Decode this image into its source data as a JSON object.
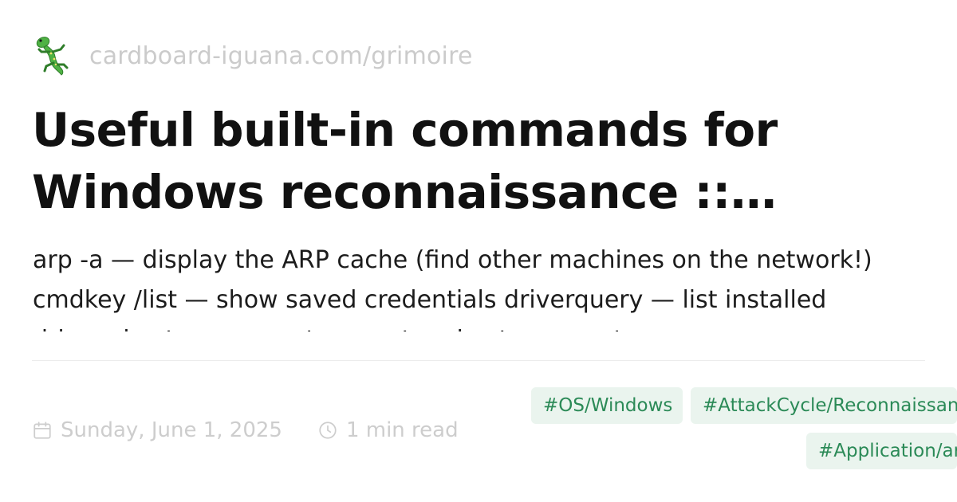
{
  "header": {
    "logo_icon": "lizard-icon",
    "site_url": "cardboard-iguana.com/grimoire"
  },
  "post": {
    "title": "Useful built-in commands for Windows reconnaissance :: Cardb…",
    "summary": "arp -a — display the ARP cache (find other machines on the network!) cmdkey /list — show saved credentials driverquery — list installed drivers hostname — return system hostname net"
  },
  "meta": {
    "date_icon": "calendar-icon",
    "date": "Sunday, June 1, 2025",
    "read_icon": "clock-icon",
    "read_time": "1 min read"
  },
  "tags": [
    {
      "label": "#OS/Windows"
    },
    {
      "label": "#AttackCycle/Reconnaissance"
    },
    {
      "label": "#Application/arp"
    }
  ],
  "colors": {
    "tag_background": "#eaf4ee",
    "tag_text": "#2b8a57",
    "muted_text": "#cbcbcb",
    "logo_green": "#4fb244"
  }
}
